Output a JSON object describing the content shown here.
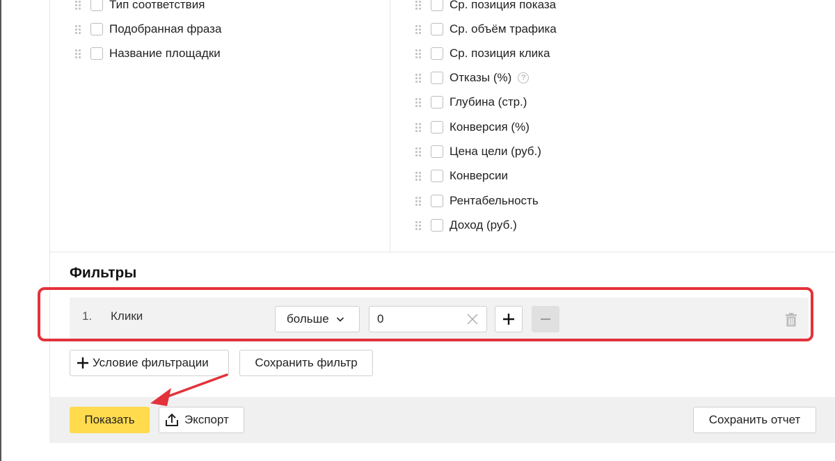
{
  "columns": {
    "left": [
      {
        "label": "Тип соответствия"
      },
      {
        "label": "Подобранная фраза"
      },
      {
        "label": "Название площадки"
      }
    ],
    "right": [
      {
        "label": "Ср. позиция показа"
      },
      {
        "label": "Ср. объём трафика"
      },
      {
        "label": "Ср. позиция клика"
      },
      {
        "label": "Отказы (%)",
        "help": "?"
      },
      {
        "label": "Глубина (стр.)"
      },
      {
        "label": "Конверсия (%)"
      },
      {
        "label": "Цена цели (руб.)"
      },
      {
        "label": "Конверсии"
      },
      {
        "label": "Рентабельность"
      },
      {
        "label": "Доход (руб.)"
      }
    ]
  },
  "filters": {
    "title": "Фильтры",
    "rows": [
      {
        "number": "1.",
        "field": "Клики",
        "operator": "больше",
        "value": "0"
      }
    ],
    "add_condition_label": "Условие фильтрации",
    "save_filter_label": "Сохранить фильтр"
  },
  "footer": {
    "show_label": "Показать",
    "export_label": "Экспорт",
    "save_report_label": "Сохранить отчет"
  },
  "colors": {
    "highlight": "#e3323a",
    "primary_button": "#ffdb4d"
  },
  "icons": [
    "drag-handle-icon",
    "help-icon",
    "chevron-down-icon",
    "clear-icon",
    "plus-icon",
    "minus-icon",
    "trash-icon",
    "export-icon",
    "annotation-arrow"
  ]
}
